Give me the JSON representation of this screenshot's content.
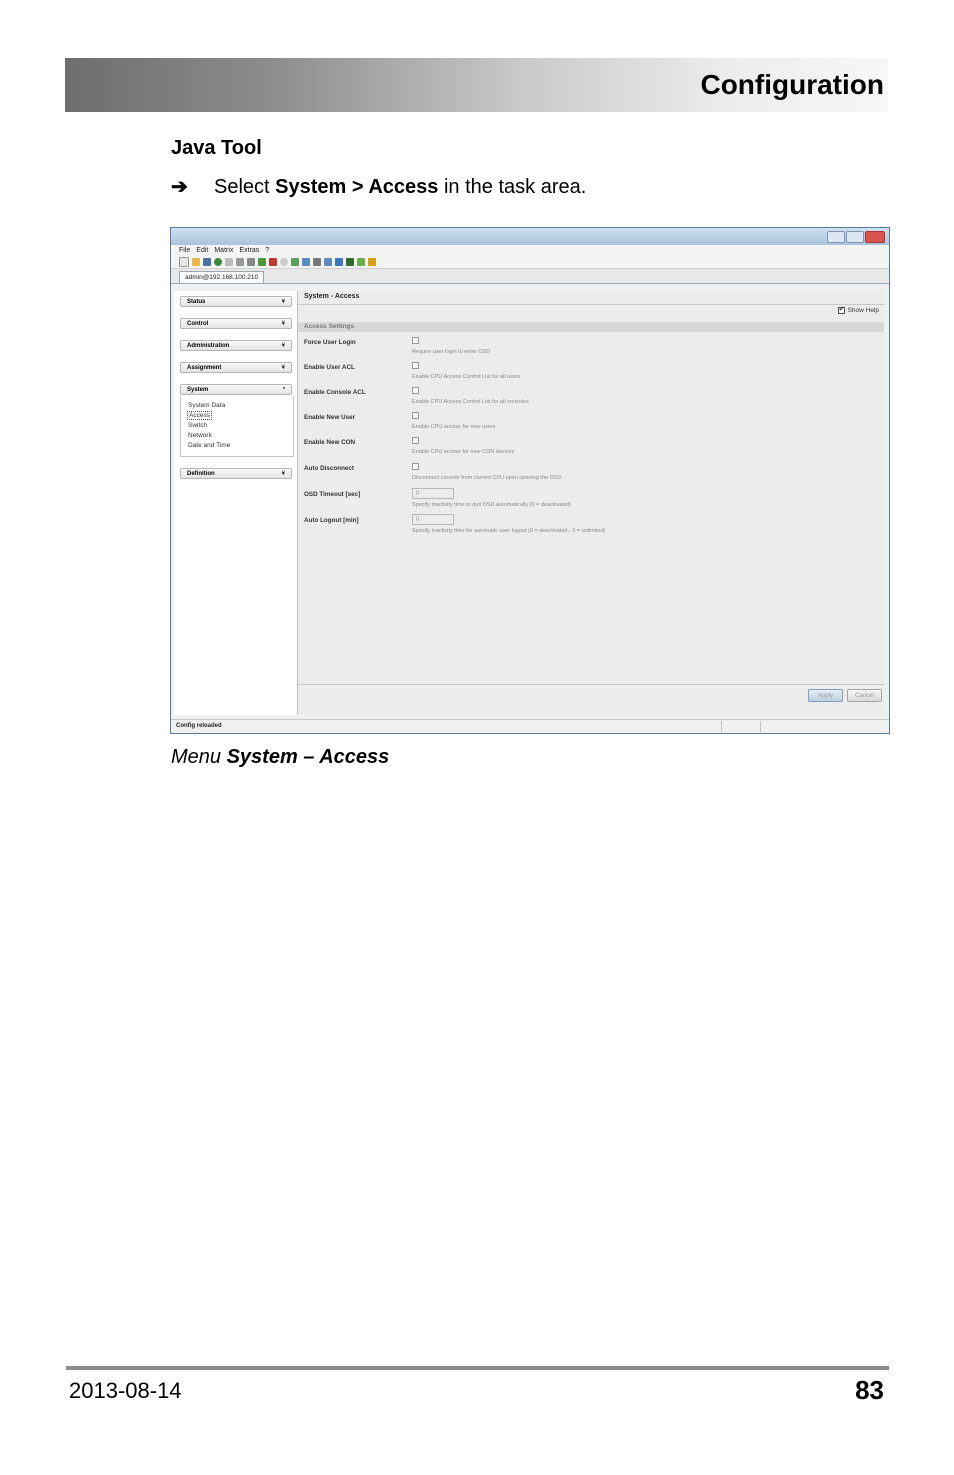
{
  "header": {
    "title": "Configuration"
  },
  "section": {
    "title": "Java Tool"
  },
  "instruction": {
    "arrow": "➔",
    "pre": "Select ",
    "bold": "System > Access",
    "post": " in the task area."
  },
  "window": {
    "menu": [
      "File",
      "Edit",
      "Matrix",
      "Extras",
      "?"
    ],
    "tab": "admin@192.168.100.210",
    "nav": [
      {
        "label": "Status",
        "chevron": "¥"
      },
      {
        "label": "Control",
        "chevron": "¥"
      },
      {
        "label": "Administration",
        "chevron": "¥"
      },
      {
        "label": "Assignment",
        "chevron": "¥"
      },
      {
        "label": "System",
        "chevron": "ª"
      },
      {
        "label": "Definition",
        "chevron": "¥"
      }
    ],
    "system_items": [
      "System Data",
      "Access",
      "Switch",
      "Network",
      "Date and Time"
    ],
    "panel_title": "System - Access",
    "show_help": "Show Help",
    "section": "Access Settings",
    "settings": [
      {
        "label": "Force User Login",
        "help": "Require user login to enter OSD"
      },
      {
        "label": "Enable User ACL",
        "help": "Enable CPU Access Control List for all users"
      },
      {
        "label": "Enable Console ACL",
        "help": "Enable CPU Access Control List for all consoles"
      },
      {
        "label": "Enable New User",
        "help": "Enable CPU access for new users"
      },
      {
        "label": "Enable New CON",
        "help": "Enable CPU access for new CON devices"
      },
      {
        "label": "Auto Disconnect",
        "help": "Disconnect console from current CPU upon opening the OSD"
      },
      {
        "label": "OSD Timeout [sec]",
        "value": "0",
        "help": "Specify inactivity time to quit OSD automatically (0 = deactivated)"
      },
      {
        "label": "Auto Logout [min]",
        "value": "0",
        "help": "Specify inactivity time for automatic user logout (0 = deactivated, -1 = unlimited)"
      }
    ],
    "apply": "Apply",
    "cancel": "Cancel",
    "status": "Config reloaded"
  },
  "caption": {
    "pre": "Menu ",
    "bold": "System – Access"
  },
  "footer": {
    "date": "2013-08-14",
    "page": "83"
  }
}
